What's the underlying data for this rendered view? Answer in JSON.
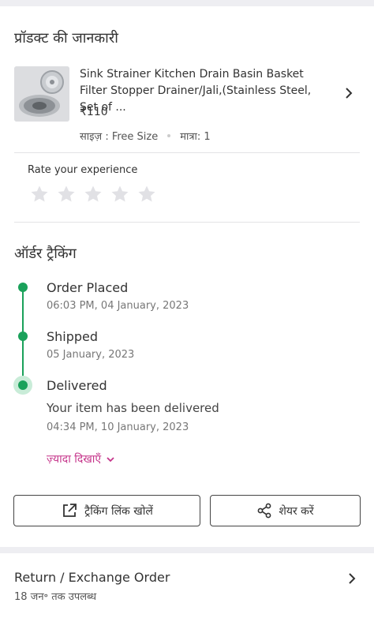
{
  "product_section": {
    "title": "प्रॉडक्ट की जानकारी",
    "product": {
      "name": "Sink Strainer Kitchen Drain Basin Basket Filter Stopper Drainer/Jali,(Stainless Steel, Set of ...",
      "price": "₹110",
      "size": "साइज़ : Free Size",
      "quantity": "मात्रा: 1",
      "thumbnail_icon": "sink-strainer-image"
    }
  },
  "rating": {
    "label": "Rate your experience",
    "stars_total": 5,
    "stars_selected": 0
  },
  "tracking": {
    "title": "ऑर्डर ट्रैकिंग",
    "steps": [
      {
        "title": "Order Placed",
        "time": "06:03 PM, 04 January, 2023"
      },
      {
        "title": "Shipped",
        "time": "05 January, 2023"
      },
      {
        "title": "Delivered",
        "description": "Your item has been delivered",
        "time": "04:34 PM, 10 January, 2023"
      }
    ],
    "show_more_label": "ज़्यादा दिखाएँ",
    "accent_color": "#1aa15a",
    "link_color": "#c5348a"
  },
  "actions": {
    "open_tracking_link": "ट्रैकिंग लिंक खोलें",
    "share": "शेयर करें"
  },
  "return_exchange": {
    "title": "Return / Exchange Order",
    "subtitle": "18 जन॰ तक उपलब्ध"
  }
}
